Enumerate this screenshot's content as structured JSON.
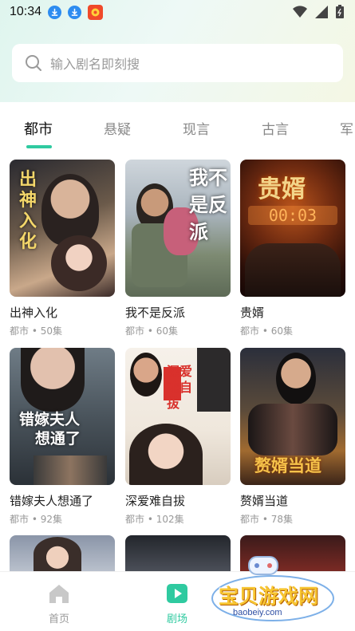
{
  "status_bar": {
    "time": "10:34"
  },
  "search": {
    "placeholder": "输入剧名即刻搜"
  },
  "tabs": [
    {
      "label": "都市",
      "active": true
    },
    {
      "label": "悬疑",
      "active": false
    },
    {
      "label": "现言",
      "active": false
    },
    {
      "label": "古言",
      "active": false
    },
    {
      "label": "军",
      "active": false
    }
  ],
  "dramas": [
    {
      "title": "出神入化",
      "meta": "都市 • 50集",
      "poster_text": "出神入化"
    },
    {
      "title": "我不是反派",
      "meta": "都市 • 60集",
      "poster_text": "我不是反派"
    },
    {
      "title": "贵婿",
      "meta": "都市 • 60集",
      "poster_text": "贵婿"
    },
    {
      "title": "错嫁夫人想通了",
      "meta": "都市 • 92集",
      "poster_text": "错嫁夫人想通了"
    },
    {
      "title": "深爱难自拔",
      "meta": "都市 • 102集",
      "poster_text": "深爱难自拔"
    },
    {
      "title": "赘婿当道",
      "meta": "都市 • 78集",
      "poster_text": "赘婿当道"
    }
  ],
  "bottom_nav": [
    {
      "label": "首页",
      "icon": "home-icon",
      "active": false
    },
    {
      "label": "剧场",
      "icon": "play-icon",
      "active": true
    }
  ],
  "watermark": {
    "text": "宝贝游戏网",
    "url": "baobeiy.com"
  },
  "colors": {
    "accent": "#2fcaa0",
    "tab_inactive": "#888888"
  }
}
